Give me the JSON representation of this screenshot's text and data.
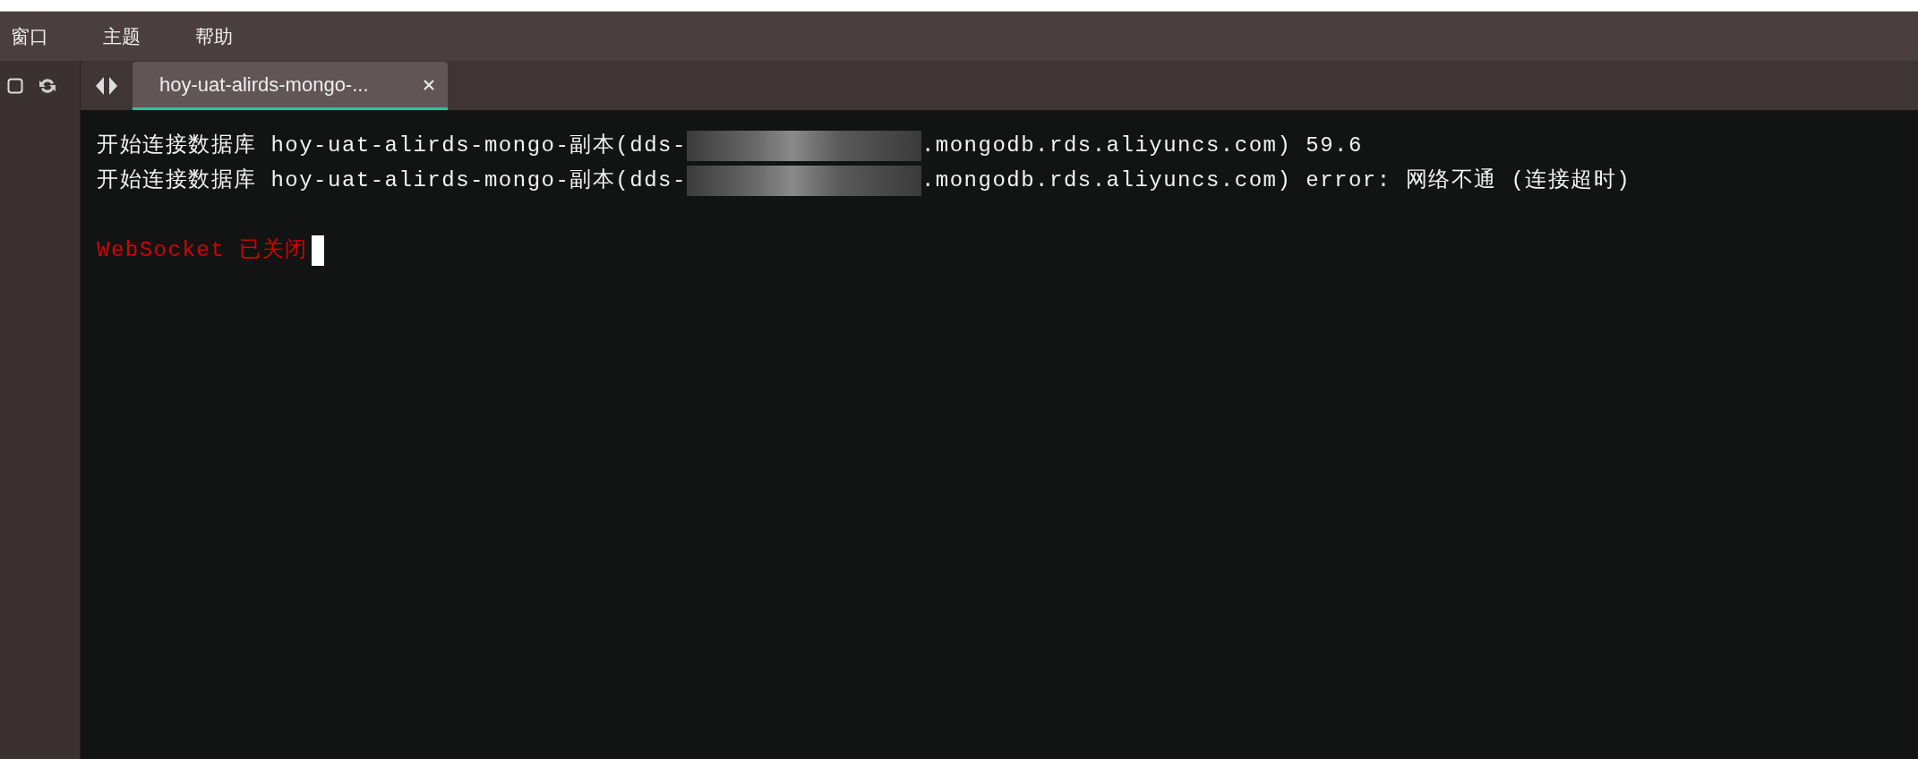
{
  "menu": [
    {
      "label": "窗口"
    },
    {
      "label": "主题"
    },
    {
      "label": "帮助"
    }
  ],
  "tabs": [
    {
      "label": "hoy-uat-alirds-mongo-...",
      "selected": true
    }
  ],
  "terminal": {
    "lines": [
      {
        "kind": "info",
        "before": "开始连接数据库 hoy-uat-alirds-mongo-副本(dds-",
        "redacted": true,
        "after": ".mongodb.rds.aliyuncs.com) 59.6"
      },
      {
        "kind": "info",
        "before": "开始连接数据库 hoy-uat-alirds-mongo-副本(dds-",
        "redacted": true,
        "after": ".mongodb.rds.aliyuncs.com) error: 网络不通 (连接超时)"
      },
      {
        "kind": "blank"
      },
      {
        "kind": "error",
        "before": "WebSocket 已关闭",
        "cursor": true
      }
    ]
  }
}
